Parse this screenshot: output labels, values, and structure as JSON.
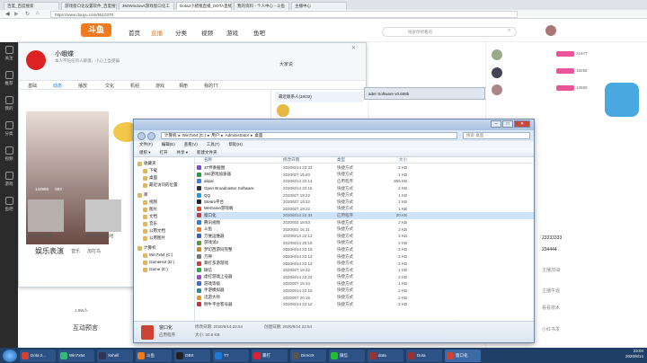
{
  "browser": {
    "tabs": [
      "百度_百度搜索",
      "游戏窗口化设置软件_百度搜索",
      "360Windows游戏窗口化工",
      "Dota2小猪猪直播_DOTA直播",
      "我的资料 - 个人中心 - 斗鱼",
      "主播中心"
    ],
    "address": "https://www.douyu.com/5510370"
  },
  "douyu_nav": {
    "logo": "斗鱼",
    "items": [
      "首页",
      "直播",
      "分类",
      "视频",
      "游戏",
      "鱼吧"
    ],
    "search_placeholder": "搜索你想看的"
  },
  "left_sidebar": [
    "关注",
    "推荐",
    "我的",
    "分类",
    "视频",
    "游戏",
    "鱼吧"
  ],
  "qq": {
    "name": "小蛾蝶",
    "signature": "本人不陪任何人聊骚，小心上当受骗",
    "tabs": [
      "基础",
      "动态",
      "播放",
      "文化",
      "机组",
      "游戏",
      "相册",
      "我的TT"
    ],
    "popup_title": "大家说",
    "popup_item": "最近联系人(18/32)",
    "stats": [
      "133958",
      "993"
    ],
    "caption_left": "抗德玛星夜夜",
    "caption_right": "把柏芳猪哈哈哈",
    "section_title": "娱乐表演",
    "section_tabs": [
      "音乐",
      "加打鸟"
    ],
    "footer_text": "1.8W人",
    "footer_title": "互动预言"
  },
  "obs_bar": "ader Software v0.658b",
  "explorer": {
    "breadcrumb": [
      "计算机",
      "Win7x64 (C:)",
      "用户",
      "Administrator",
      "桌面"
    ],
    "search_placeholder": "搜索 桌面",
    "menu": [
      "文件(F)",
      "编辑(E)",
      "查看(V)",
      "工具(T)",
      "帮助(H)"
    ],
    "commands": [
      "组织 ▾",
      "打开",
      "共享 ▾",
      "新建文件夹"
    ],
    "headers": [
      "名称",
      "修改日期",
      "类型",
      "大小"
    ],
    "nav": {
      "favorites_label": "收藏夹",
      "favorites": [
        "下载",
        "桌面",
        "最近访问的位置"
      ],
      "libraries_label": "库",
      "libraries": [
        "视频",
        "图片",
        "文档",
        "音乐",
        "公用文档",
        "公用图片"
      ],
      "computer_label": "计算机",
      "drives": [
        "Win7x64 (C:)",
        "GameHot (D:)",
        "Game (E:)"
      ]
    },
    "files": [
      {
        "name": "3T伴奏截图",
        "date": "2020/8/14 22:33",
        "type": "快捷方式",
        "size": "2 KB",
        "color": "#7a4fcf"
      },
      {
        "name": "360游戏加速器",
        "date": "2020/8/7 15:40",
        "type": "快捷方式",
        "size": "1 KB",
        "color": "#2b9b3a"
      },
      {
        "name": "alipal",
        "date": "2020/8/14 22:14",
        "type": "应用程序",
        "size": "855 KB",
        "color": "#3c7fe0"
      },
      {
        "name": "Open Broadcaster Software",
        "date": "2020/8/14 22:16",
        "type": "快捷方式",
        "size": "2 KB",
        "color": "#333333"
      },
      {
        "name": "QQ",
        "date": "2020/8/7 19:22",
        "type": "快捷方式",
        "size": "1 KB",
        "color": "#1aa0e8"
      },
      {
        "name": "Steam平台",
        "date": "2020/8/7 19:22",
        "type": "快捷方式",
        "size": "1 KB",
        "color": "#1b2838"
      },
      {
        "name": "WeGame游戏端",
        "date": "2020/8/7 19:22",
        "type": "快捷方式",
        "size": "1 KB",
        "color": "#e04b2b"
      },
      {
        "name": "窗口化",
        "date": "2020/8/14 22:34",
        "type": "应用程序",
        "size": "20 KB",
        "color": "#c43c3c",
        "selected": true
      },
      {
        "name": "腾讯视频",
        "date": "2020/8/2 18:53",
        "type": "快捷方式",
        "size": "2 KB",
        "color": "#2f7de0"
      },
      {
        "name": "斗鱼",
        "date": "2020/8/2 16:11",
        "type": "快捷方式",
        "size": "2 KB",
        "color": "#f07b1f"
      },
      {
        "name": "万维运维器",
        "date": "2020/8/14 22:13",
        "type": "快捷方式",
        "size": "2 KB",
        "color": "#3b5fbf"
      },
      {
        "name": "游戏试2",
        "date": "2020/8/14 20:16",
        "type": "快捷方式",
        "size": "2 KB",
        "color": "#5a9a3c"
      },
      {
        "name": "梦幻西游同完整",
        "date": "2020/8/14 22:18",
        "type": "快捷方式",
        "size": "2 KB",
        "color": "#c2892b"
      },
      {
        "name": "万神",
        "date": "2020/8/14 22:13",
        "type": "快捷方式",
        "size": "2 KB",
        "color": "#777777"
      },
      {
        "name": "暴打多游游戏",
        "date": "2020/8/14 22:13",
        "type": "快捷方式",
        "size": "2 KB",
        "color": "#d23d3d"
      },
      {
        "name": "微信",
        "date": "2020/8/7 19:22",
        "type": "快捷方式",
        "size": "1 KB",
        "color": "#2bb33d"
      },
      {
        "name": "虚打游戏上号器",
        "date": "2020/8/14 22:22",
        "type": "快捷方式",
        "size": "2 KB",
        "color": "#a04ad0"
      },
      {
        "name": "游戏等级",
        "date": "2020/8/7 15:34",
        "type": "快捷方式",
        "size": "1 KB",
        "color": "#3e6dcc"
      },
      {
        "name": "手游模拟器",
        "date": "2020/8/14 22:15",
        "type": "快捷方式",
        "size": "2 KB",
        "color": "#2a8f8f"
      },
      {
        "name": "迅游大师",
        "date": "2020/8/7 20:16",
        "type": "快捷方式",
        "size": "2 KB",
        "color": "#e09a2a"
      },
      {
        "name": "明牛平台客号器",
        "date": "2020/8/14 22:12",
        "type": "快捷方式",
        "size": "2 KB",
        "color": "#cc3333"
      }
    ],
    "details": {
      "name": "窗口化",
      "mod_label": "修改日期: 2020/8/14 22:54",
      "create_label": "创建日期: 2020/8/14 22:54",
      "type": "应用程序",
      "size": "大小: 20.6 KB"
    }
  },
  "chat": {
    "ranks": [
      "21977",
      "18259",
      "13590"
    ],
    "messages": [
      "主播加油",
      "23333333",
      "234444",
      "主播牛逼",
      "看看技术",
      "小红书发"
    ]
  },
  "taskbar": {
    "items": [
      "Dota 2...",
      "Win7x64",
      "Xshell",
      "斗鱼",
      "OBS",
      "TT",
      "暴打",
      "DirectX",
      "微信",
      "dota",
      "Dota",
      "窗口化"
    ],
    "clock_time": "23:04",
    "clock_date": "2020/8/14"
  }
}
